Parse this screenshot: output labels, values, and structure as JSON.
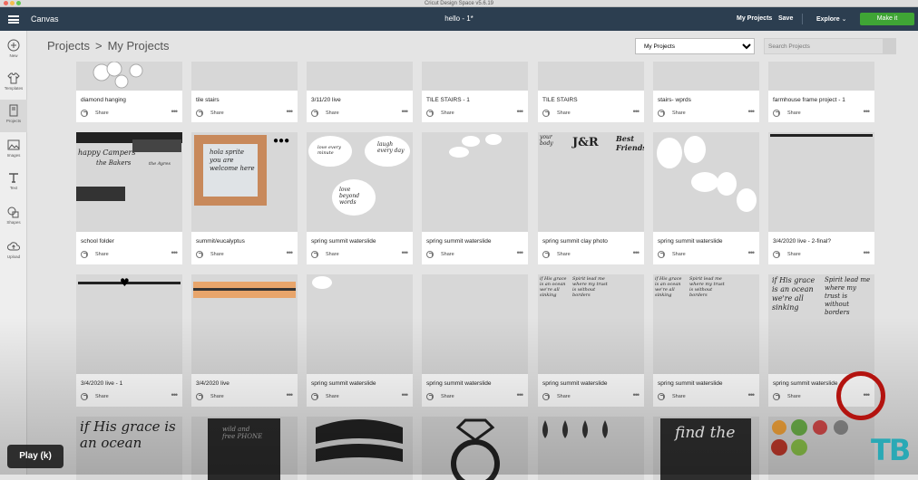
{
  "window": {
    "title": "Cricut Design Space  v5.6.19"
  },
  "topbar": {
    "canvas_label": "Canvas",
    "document_title": "hello - 1*",
    "my_projects": "My Projects",
    "save": "Save",
    "explore": "Explore",
    "make_it": "Make it"
  },
  "sidebar": {
    "items": [
      {
        "label": "New",
        "icon": "plus-icon"
      },
      {
        "label": "Templates",
        "icon": "shirt-icon"
      },
      {
        "label": "Projects",
        "icon": "projects-icon"
      },
      {
        "label": "Images",
        "icon": "image-icon"
      },
      {
        "label": "Text",
        "icon": "text-icon"
      },
      {
        "label": "Shapes",
        "icon": "shapes-icon"
      },
      {
        "label": "Upload",
        "icon": "upload-icon"
      }
    ]
  },
  "header": {
    "breadcrumb_root": "Projects",
    "breadcrumb_sep": ">",
    "breadcrumb_current": "My Projects",
    "filter_selected": "My Projects",
    "search_placeholder": "Search Projects"
  },
  "cards": {
    "share_label": "Share",
    "more_label": "•••",
    "row1": [
      "diamond hanging",
      "tile stairs",
      "3/11/20 live",
      "TILE STAIRS - 1",
      "TILE STAIRS",
      "stairs- wprds",
      "farmhouse frame project - 1"
    ],
    "row2": [
      "school folder",
      "summit/eucalyptus",
      "spring summit waterslide",
      "spring summit waterslide",
      "spring summit clay photo",
      "spring summit waterslide",
      "3/4/2020 live - 2-final?"
    ],
    "row3": [
      "3/4/2020 live - 1",
      "3/4/2020 live",
      "spring summit waterslide",
      "spring summit waterslide",
      "spring summit waterslide",
      "spring summit waterslide",
      "spring summit waterslide"
    ]
  },
  "thumb_text": {
    "happy_campers": "happy Campers",
    "the_bakers": "the Bakers",
    "the_ayres": "the Ayres",
    "hola": "hola sprite you are welcome here",
    "love_every": "love every minute",
    "laugh": "laugh every day",
    "love_beyond": "love beyond words",
    "jr": "J&R",
    "best": "Best Friends",
    "your_body": "your body",
    "grace": "if His grace is an ocean we're all sinking",
    "spirit": "Spirit lead me where my trust is without borders",
    "find_the": "find the",
    "wild": "wild and free PHONE",
    "big_grace": "if His grace is an ocean"
  },
  "overlay": {
    "play": "Play (k)",
    "watermark": "TB"
  },
  "colors": {
    "topbar": "#2c3e50",
    "make_it": "#3fa535",
    "highlight_circle": "#b3130f",
    "watermark": "#2aa9b5"
  }
}
